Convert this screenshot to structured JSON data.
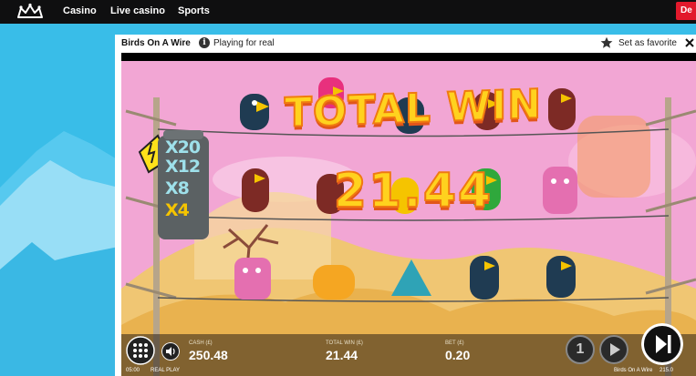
{
  "nav": {
    "links": [
      "Casino",
      "Live casino",
      "Sports"
    ],
    "deposit_label": "De"
  },
  "game_window": {
    "title": "Birds On A Wire",
    "info_symbol": "i",
    "mode": "Playing for real",
    "favorite_label": "Set as favorite"
  },
  "game": {
    "win_title": "TOTAL WIN",
    "win_amount": "21.44",
    "multipliers": [
      "X20",
      "X12",
      "X8",
      "X4"
    ],
    "cash_label": "CASH (£)",
    "cash_value": "250.48",
    "total_win_label": "TOTAL WIN (£)",
    "total_win_value": "21.44",
    "bet_label": "BET (£)",
    "bet_value": "0.20",
    "clock": "05:00",
    "play_mode": "REAL PLAY",
    "footer_title": "Birds On A Wire",
    "version": "215.0",
    "autoplay_label": "1"
  },
  "colors": {
    "nav_bg": "#0f0f10",
    "page_bg": "#39bde8",
    "deposit": "#e2192c",
    "sky": "#f2a6d4",
    "win_text": "#ffd21e"
  }
}
